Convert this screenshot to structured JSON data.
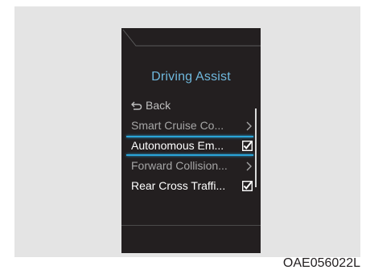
{
  "screen": {
    "title": "Driving Assist",
    "back_label": "Back",
    "menu_items": [
      {
        "label": "Smart Cruise Co...",
        "indicator": "chevron-right-icon"
      },
      {
        "label": "Autonomous Em...",
        "indicator": "checkbox-checked-icon",
        "checked": true
      },
      {
        "label": "Forward Collision...",
        "indicator": "chevron-right-icon"
      },
      {
        "label": "Rear Cross Traffi...",
        "indicator": "checkbox-checked-icon",
        "checked": true
      }
    ],
    "selected_index": 1
  },
  "image_code": "OAE056022L",
  "colors": {
    "title": "#6fb8dd",
    "selection": "#2aa4d8",
    "screen_bg": "#231f20",
    "panel_bg": "#e4e4e4"
  }
}
